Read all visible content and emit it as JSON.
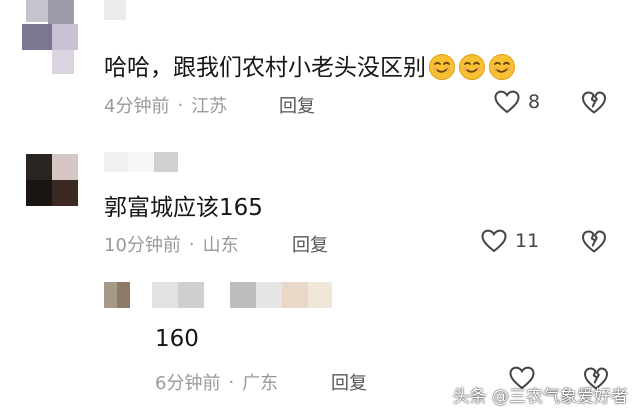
{
  "comments": [
    {
      "text": "哈哈，跟我们农村小老头没区别",
      "emoji_count": 3,
      "emoji_icon": "smirking-face-icon",
      "time": "4分钟前",
      "separator": "·",
      "location": "江苏",
      "reply_label": "回复",
      "likes": "8"
    },
    {
      "text": "郭富城应该165",
      "time": "10分钟前",
      "separator": "·",
      "location": "山东",
      "reply_label": "回复",
      "likes": "11"
    },
    {
      "text": "160",
      "time": "6分钟前",
      "separator": "·",
      "location": "广东",
      "reply_label": "回复",
      "likes": ""
    }
  ],
  "watermark": "头条 @三农气象爱好者",
  "colors": {
    "meta_gray": "#9a9a9a",
    "icon_gray": "#444444",
    "text": "#161616"
  }
}
